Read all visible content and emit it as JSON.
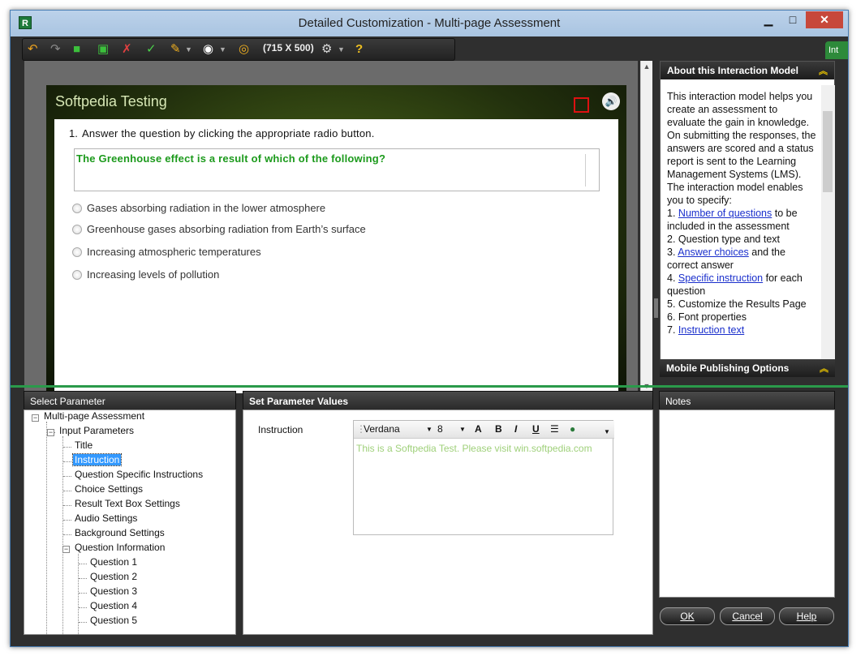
{
  "window": {
    "app_icon_letter": "R",
    "title": "Detailed Customization - Multi-page Assessment",
    "minimize": "▁",
    "maximize": "□",
    "close": "✕"
  },
  "toolbar": {
    "resolution": "(715 X 500)",
    "side_tab": "Int"
  },
  "slide": {
    "title": "Softpedia Testing",
    "question_number": "1.",
    "question_instruction": "Answer the question by clicking the appropriate radio button.",
    "question_text": "The Greenhouse effect is a result of which of the following?",
    "choices": [
      "Gases absorbing radiation in the lower atmosphere",
      "Greenhouse gases absorbing radiation from Earth’s surface",
      "Increasing atmospheric temperatures",
      "Increasing levels of pollution"
    ]
  },
  "about_panel": {
    "title": "About this Interaction Model",
    "intro": "This interaction model helps you create an assessment to evaluate the gain in knowledge. On submitting the responses, the answers are scored and a status report is sent to the Learning Management Systems (LMS). The interaction model enables you to specify:",
    "items": [
      {
        "num": "1.",
        "link": "Number of questions",
        "rest": " to be included in the assessment"
      },
      {
        "num": "2.",
        "link": "",
        "rest": " Question type and text"
      },
      {
        "num": "3.",
        "link": "Answer choices",
        "rest": " and the correct answer"
      },
      {
        "num": "4.",
        "link": "Specific instruction",
        "rest": " for each question"
      },
      {
        "num": "5.",
        "link": "",
        "rest": " Customize the Results Page"
      },
      {
        "num": "6.",
        "link": "",
        "rest": " Font properties"
      },
      {
        "num": "7.",
        "link": "Instruction text",
        "rest": ""
      }
    ],
    "mobile_title": "Mobile Publishing Options"
  },
  "select_parameter": {
    "header": "Select Parameter",
    "root": "Multi-page Assessment",
    "input_parameters": "Input Parameters",
    "items": [
      "Title",
      "Instruction",
      "Question Specific Instructions",
      "Choice Settings",
      "Result Text Box Settings",
      "Audio Settings",
      "Background Settings"
    ],
    "question_information": "Question Information",
    "questions": [
      "Question  1",
      "Question  2",
      "Question  3",
      "Question  4",
      "Question  5"
    ]
  },
  "set_parameter": {
    "header": "Set Parameter Values",
    "label": "Instruction",
    "font_name": "Verdana",
    "font_size": "8",
    "text": "This is a Softpedia Test. Please visit win.softpedia.com"
  },
  "notes": {
    "header": "Notes"
  },
  "buttons": {
    "ok": "OK",
    "cancel": "Cancel",
    "help": "Help"
  },
  "colors": {
    "accent_green": "#2a9a4a",
    "question_green": "#1c9a1c",
    "link_blue": "#1a2fcc",
    "selection_blue": "#3399ff"
  }
}
